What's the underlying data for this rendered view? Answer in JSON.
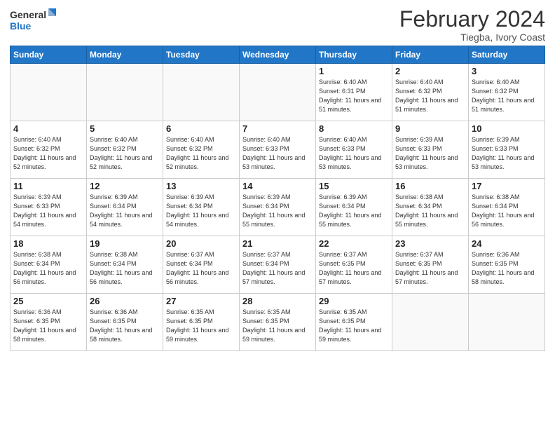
{
  "logo": {
    "line1": "General",
    "line2": "Blue"
  },
  "title": "February 2024",
  "subtitle": "Tiegba, Ivory Coast",
  "days_of_week": [
    "Sunday",
    "Monday",
    "Tuesday",
    "Wednesday",
    "Thursday",
    "Friday",
    "Saturday"
  ],
  "weeks": [
    [
      {
        "day": "",
        "info": ""
      },
      {
        "day": "",
        "info": ""
      },
      {
        "day": "",
        "info": ""
      },
      {
        "day": "",
        "info": ""
      },
      {
        "day": "1",
        "info": "Sunrise: 6:40 AM\nSunset: 6:31 PM\nDaylight: 11 hours and 51 minutes."
      },
      {
        "day": "2",
        "info": "Sunrise: 6:40 AM\nSunset: 6:32 PM\nDaylight: 11 hours and 51 minutes."
      },
      {
        "day": "3",
        "info": "Sunrise: 6:40 AM\nSunset: 6:32 PM\nDaylight: 11 hours and 51 minutes."
      }
    ],
    [
      {
        "day": "4",
        "info": "Sunrise: 6:40 AM\nSunset: 6:32 PM\nDaylight: 11 hours and 52 minutes."
      },
      {
        "day": "5",
        "info": "Sunrise: 6:40 AM\nSunset: 6:32 PM\nDaylight: 11 hours and 52 minutes."
      },
      {
        "day": "6",
        "info": "Sunrise: 6:40 AM\nSunset: 6:32 PM\nDaylight: 11 hours and 52 minutes."
      },
      {
        "day": "7",
        "info": "Sunrise: 6:40 AM\nSunset: 6:33 PM\nDaylight: 11 hours and 53 minutes."
      },
      {
        "day": "8",
        "info": "Sunrise: 6:40 AM\nSunset: 6:33 PM\nDaylight: 11 hours and 53 minutes."
      },
      {
        "day": "9",
        "info": "Sunrise: 6:39 AM\nSunset: 6:33 PM\nDaylight: 11 hours and 53 minutes."
      },
      {
        "day": "10",
        "info": "Sunrise: 6:39 AM\nSunset: 6:33 PM\nDaylight: 11 hours and 53 minutes."
      }
    ],
    [
      {
        "day": "11",
        "info": "Sunrise: 6:39 AM\nSunset: 6:33 PM\nDaylight: 11 hours and 54 minutes."
      },
      {
        "day": "12",
        "info": "Sunrise: 6:39 AM\nSunset: 6:34 PM\nDaylight: 11 hours and 54 minutes."
      },
      {
        "day": "13",
        "info": "Sunrise: 6:39 AM\nSunset: 6:34 PM\nDaylight: 11 hours and 54 minutes."
      },
      {
        "day": "14",
        "info": "Sunrise: 6:39 AM\nSunset: 6:34 PM\nDaylight: 11 hours and 55 minutes."
      },
      {
        "day": "15",
        "info": "Sunrise: 6:39 AM\nSunset: 6:34 PM\nDaylight: 11 hours and 55 minutes."
      },
      {
        "day": "16",
        "info": "Sunrise: 6:38 AM\nSunset: 6:34 PM\nDaylight: 11 hours and 55 minutes."
      },
      {
        "day": "17",
        "info": "Sunrise: 6:38 AM\nSunset: 6:34 PM\nDaylight: 11 hours and 56 minutes."
      }
    ],
    [
      {
        "day": "18",
        "info": "Sunrise: 6:38 AM\nSunset: 6:34 PM\nDaylight: 11 hours and 56 minutes."
      },
      {
        "day": "19",
        "info": "Sunrise: 6:38 AM\nSunset: 6:34 PM\nDaylight: 11 hours and 56 minutes."
      },
      {
        "day": "20",
        "info": "Sunrise: 6:37 AM\nSunset: 6:34 PM\nDaylight: 11 hours and 56 minutes."
      },
      {
        "day": "21",
        "info": "Sunrise: 6:37 AM\nSunset: 6:34 PM\nDaylight: 11 hours and 57 minutes."
      },
      {
        "day": "22",
        "info": "Sunrise: 6:37 AM\nSunset: 6:35 PM\nDaylight: 11 hours and 57 minutes."
      },
      {
        "day": "23",
        "info": "Sunrise: 6:37 AM\nSunset: 6:35 PM\nDaylight: 11 hours and 57 minutes."
      },
      {
        "day": "24",
        "info": "Sunrise: 6:36 AM\nSunset: 6:35 PM\nDaylight: 11 hours and 58 minutes."
      }
    ],
    [
      {
        "day": "25",
        "info": "Sunrise: 6:36 AM\nSunset: 6:35 PM\nDaylight: 11 hours and 58 minutes."
      },
      {
        "day": "26",
        "info": "Sunrise: 6:36 AM\nSunset: 6:35 PM\nDaylight: 11 hours and 58 minutes."
      },
      {
        "day": "27",
        "info": "Sunrise: 6:35 AM\nSunset: 6:35 PM\nDaylight: 11 hours and 59 minutes."
      },
      {
        "day": "28",
        "info": "Sunrise: 6:35 AM\nSunset: 6:35 PM\nDaylight: 11 hours and 59 minutes."
      },
      {
        "day": "29",
        "info": "Sunrise: 6:35 AM\nSunset: 6:35 PM\nDaylight: 11 hours and 59 minutes."
      },
      {
        "day": "",
        "info": ""
      },
      {
        "day": "",
        "info": ""
      }
    ]
  ]
}
